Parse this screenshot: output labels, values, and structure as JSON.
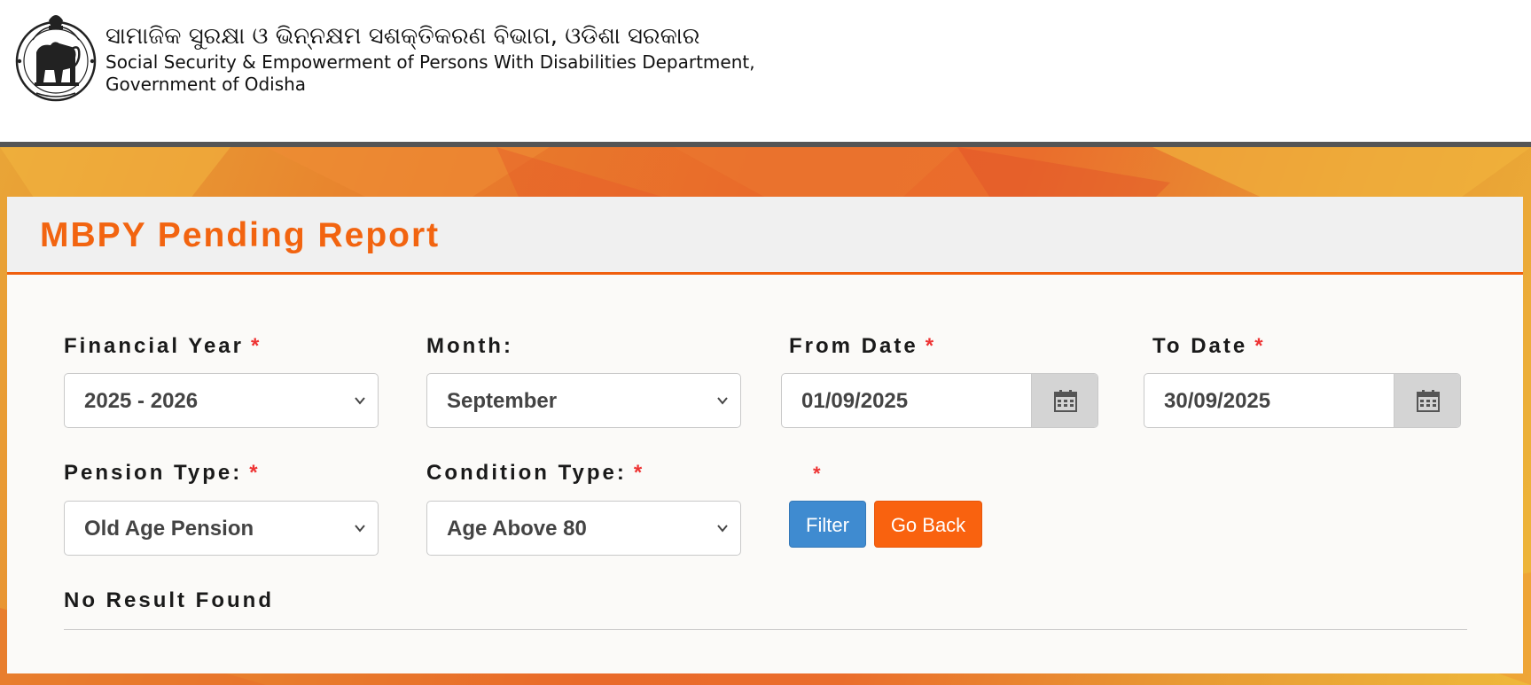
{
  "header": {
    "emblem_icon": "odisha-state-emblem-icon",
    "odia_title": "ସାମାଜିକ ସୁରକ୍ଷା ଓ ଭିନ୍ନକ୍ଷମ ସଶକ୍ତିକରଣ ବିଭାଗ, ଓଡିଶା  ସରକାର",
    "department_line1": "Social Security & Empowerment of Persons With Disabilities Department,",
    "department_line2": "Government of Odisha"
  },
  "report": {
    "title": "MBPY Pending Report"
  },
  "form": {
    "financial_year": {
      "label": "Financial Year",
      "required_mark": "*",
      "value": "2025 - 2026"
    },
    "month": {
      "label": "Month:",
      "value": "September"
    },
    "from_date": {
      "label": "From Date",
      "required_mark": "*",
      "value": "01/09/2025",
      "icon": "calendar-icon"
    },
    "to_date": {
      "label": "To Date",
      "required_mark": "*",
      "value": "30/09/2025",
      "icon": "calendar-icon"
    },
    "pension_type": {
      "label": "Pension Type:",
      "required_mark": "*",
      "value": "Old Age Pension"
    },
    "condition_type": {
      "label": "Condition Type:",
      "required_mark": "*",
      "value": "Age Above 80"
    },
    "unlabeled_required_mark": "*",
    "filter_button": "Filter",
    "go_back_button": "Go Back"
  },
  "result": {
    "message": "No Result Found"
  },
  "colors": {
    "accent_orange": "#f26410",
    "filter_blue": "#3f8bd0",
    "go_back_orange": "#f9620f",
    "required_red": "#e33333"
  }
}
